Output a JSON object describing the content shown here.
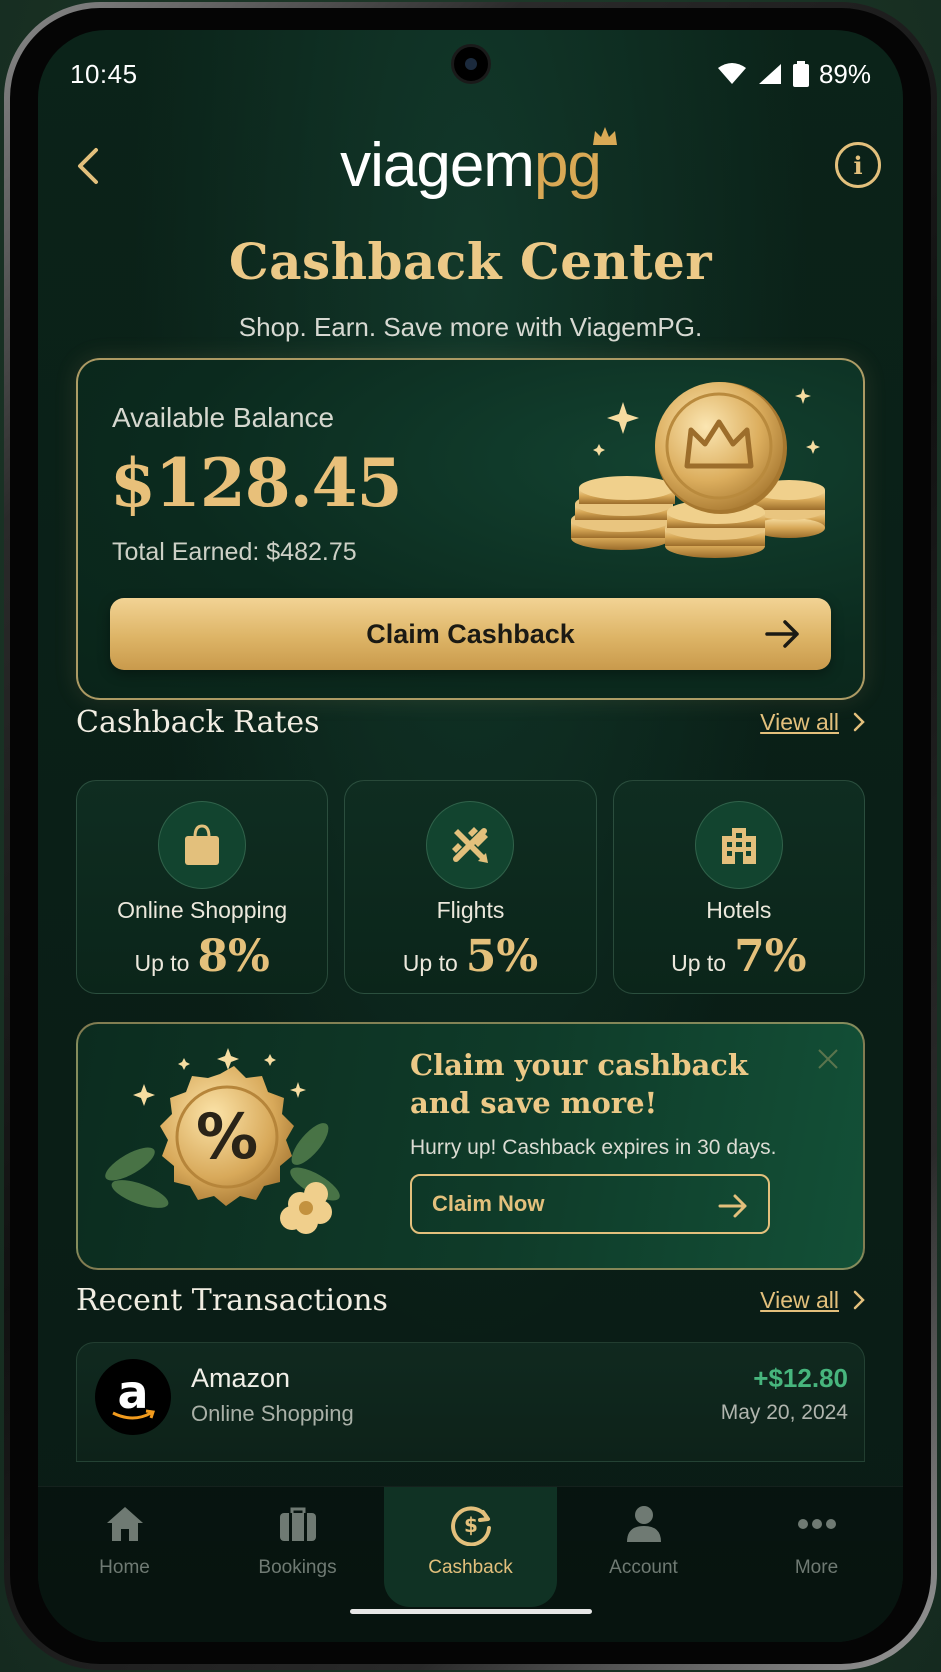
{
  "status": {
    "time": "10:45",
    "battery": "89%"
  },
  "header": {
    "logo_part1": "viagem",
    "logo_part2": "pg"
  },
  "page": {
    "title": "Cashback Center",
    "subtitle": "Shop. Earn. Save more with ViagemPG."
  },
  "balance": {
    "label": "Available Balance",
    "amount": "$128.45",
    "total_earned": "Total Earned: $482.75",
    "claim_button": "Claim Cashback"
  },
  "rates": {
    "title": "Cashback Rates",
    "view_all": "View all",
    "items": [
      {
        "name": "Online Shopping",
        "prefix": "Up to",
        "percent": "8%",
        "icon": "shopping-bag-icon"
      },
      {
        "name": "Flights",
        "prefix": "Up to",
        "percent": "5%",
        "icon": "airplane-icon"
      },
      {
        "name": "Hotels",
        "prefix": "Up to",
        "percent": "7%",
        "icon": "hotel-icon"
      }
    ]
  },
  "promo": {
    "title": "Claim your cashback and save more!",
    "subtitle": "Hurry up! Cashback expires in 30 days.",
    "button": "Claim Now"
  },
  "transactions": {
    "title": "Recent Transactions",
    "view_all": "View all",
    "items": [
      {
        "logo_letter": "a",
        "merchant": "Amazon",
        "category": "Online Shopping",
        "amount": "+$12.80",
        "date": "May 20, 2024"
      }
    ]
  },
  "nav": {
    "items": [
      {
        "label": "Home",
        "icon": "home-icon",
        "active": false
      },
      {
        "label": "Bookings",
        "icon": "briefcase-icon",
        "active": false
      },
      {
        "label": "Cashback",
        "icon": "cashback-icon",
        "active": true
      },
      {
        "label": "Account",
        "icon": "person-icon",
        "active": false
      },
      {
        "label": "More",
        "icon": "more-dots-icon",
        "active": false
      }
    ]
  },
  "colors": {
    "gold": "#e3c07c",
    "background": "#0b2319",
    "positive": "#47b57d"
  }
}
